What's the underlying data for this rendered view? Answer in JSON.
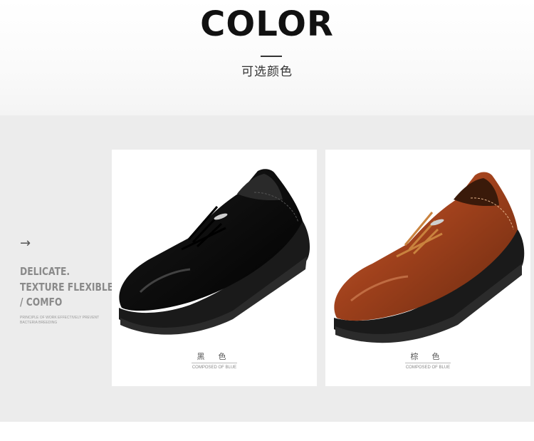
{
  "header": {
    "title": "COLOR",
    "subtitle": "可选颜色"
  },
  "side": {
    "arrow": "→",
    "line1": "DELICATE.",
    "line2": "TEXTURE FLEXIBLE",
    "line3": "/ COMFO",
    "small1": "PRINCIPLE OF WORK EFFECTIVELY PREVENT",
    "small2": "BACTERIA BREEDING"
  },
  "products": [
    {
      "name": "黑 色",
      "caption": "COMPOSED OF BLUE",
      "color": "#111111"
    },
    {
      "name": "棕 色",
      "caption": "COMPOSED OF BLUE",
      "color": "#a0411c"
    }
  ],
  "colors": {
    "background_band": "#ececec",
    "title": "#111111"
  }
}
